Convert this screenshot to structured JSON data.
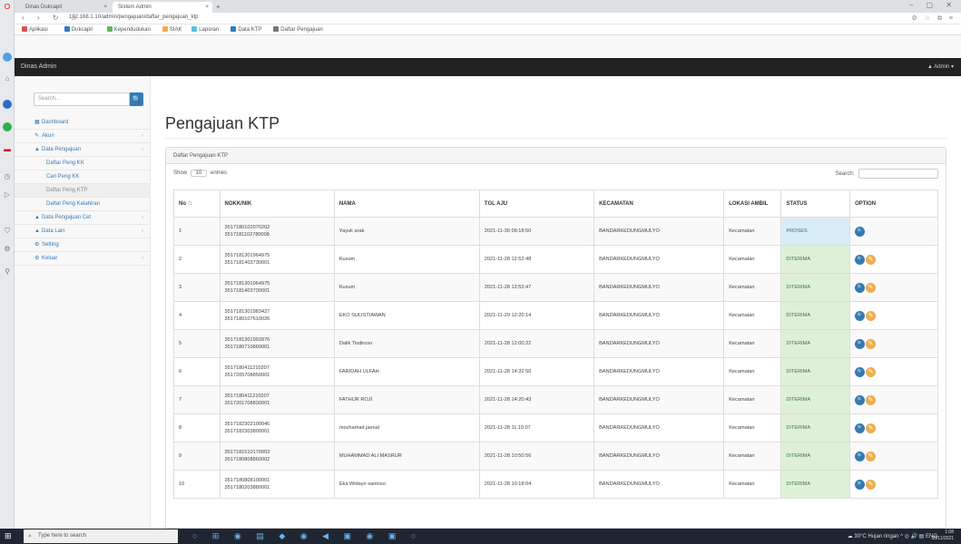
{
  "browser": {
    "tabs": [
      {
        "title": "Dinas Dukcapil",
        "close": "×"
      },
      {
        "title": "Sistem Admin",
        "close": "×"
      }
    ],
    "new_tab": "+",
    "window_controls": "– ▢ ✕",
    "nav_glyphs": "‹ › ↻ ⌂",
    "url": "192.168.1.10/admin/pengajuan/daftar_pengajuan_ktp",
    "extensions": "⚙ ☆ ⧉ ≡",
    "bookmarks": [
      {
        "label": "Aplikasi",
        "color": "#d9534f"
      },
      {
        "label": "Dukcapil",
        "color": "#337ab7"
      },
      {
        "label": "Kependudukan",
        "color": "#5cb85c"
      },
      {
        "label": "SIAK",
        "color": "#f0ad4e"
      },
      {
        "label": "Laporan",
        "color": "#5bc0de"
      },
      {
        "label": "Data KTP",
        "color": "#337ab7"
      },
      {
        "label": "Daftar Pengajuan",
        "color": "#777777"
      }
    ]
  },
  "app": {
    "brand": "Dinas Admin",
    "user_menu": "▲ Admin ▾"
  },
  "sidebar": {
    "search_placeholder": "Search...",
    "search_button": "🔍",
    "items": [
      {
        "label": "Dashboard",
        "icon": "▦",
        "level": "top",
        "caret": ""
      },
      {
        "label": "Akun",
        "icon": "✎",
        "level": "top",
        "caret": "‹"
      },
      {
        "label": "Data Pengajuan",
        "icon": "▲",
        "level": "top",
        "caret": "‹"
      },
      {
        "label": "Daftar Peng KK",
        "icon": "",
        "level": "sub",
        "caret": ""
      },
      {
        "label": "Cari Peng KK",
        "icon": "",
        "level": "sub",
        "caret": ""
      },
      {
        "label": "Daftar Peng KTP",
        "icon": "",
        "level": "sub",
        "active": true,
        "caret": ""
      },
      {
        "label": "Daftar Peng Kelahiran",
        "icon": "",
        "level": "sub",
        "caret": ""
      },
      {
        "label": "Data Pengajuan Cet",
        "icon": "▲",
        "level": "top",
        "caret": "‹"
      },
      {
        "label": "Data Lain",
        "icon": "▲",
        "level": "top",
        "caret": "‹"
      },
      {
        "label": "Setting",
        "icon": "⚙",
        "level": "top",
        "caret": ""
      },
      {
        "label": "Keluar",
        "icon": "⚙",
        "level": "top",
        "caret": "‹"
      }
    ]
  },
  "main": {
    "title": "Pengajuan KTP",
    "panel_heading": "Daftar Pengajuan KTP",
    "show_label": "Show",
    "show_value": "10",
    "entries_label": "entries",
    "search_label": "Search:",
    "columns": [
      "No",
      "NOKK/NIK",
      "NAMA",
      "TGL AJU",
      "KECAMATAN",
      "LOKASI AMBIL",
      "STATUS",
      "OPTION"
    ],
    "rows": [
      {
        "no": "1",
        "nik1": "3517180102070202",
        "nik2": "3517181102780008",
        "nama": "Yayuk arak",
        "tgl": "2021-11-30 09:18:50",
        "kec": "BANDARKEDUNGMULYO",
        "lokasi": "Kecamatan",
        "status": "PROSES",
        "kind": "proses",
        "edit": false
      },
      {
        "no": "2",
        "nik1": "3517181301964975",
        "nik2": "3517181403730001",
        "nama": "Kusum",
        "tgl": "2021-11-28 12:52:48",
        "kec": "BANDARKEDUNGMULYO",
        "lokasi": "Kecamatan",
        "status": "DITERIMA",
        "kind": "ok",
        "edit": true
      },
      {
        "no": "3",
        "nik1": "3517181301964975",
        "nik2": "3517181403730001",
        "nama": "Kusum",
        "tgl": "2021-11-28 12:53:47",
        "kec": "BANDARKEDUNGMULYO",
        "lokasi": "Kecamatan",
        "status": "DITERIMA",
        "kind": "ok",
        "edit": true
      },
      {
        "no": "4",
        "nik1": "3517181301983427",
        "nik2": "3517180107610026",
        "nama": "EKO SULISTIAWAN",
        "tgl": "2021-11-29 12:20:14",
        "kec": "BANDARKEDUNGMULYO",
        "lokasi": "Kecamatan",
        "status": "DITERIMA",
        "kind": "ok",
        "edit": true
      },
      {
        "no": "5",
        "nik1": "3517181301993976",
        "nik2": "3517180710860001",
        "nama": "Dalik Tisdiroso",
        "tgl": "2021-11-28 12:00:22",
        "kec": "BANDARKEDUNGMULYO",
        "lokasi": "Kecamatan",
        "status": "DITERIMA",
        "kind": "ok",
        "edit": true
      },
      {
        "no": "6",
        "nik1": "3517180411210207",
        "nik2": "3517205708850001",
        "nama": "FARIDAH ULFAH",
        "tgl": "2021-11-28 14:32:50",
        "kec": "BANDARKEDUNGMULYO",
        "lokasi": "Kecamatan",
        "status": "DITERIMA",
        "kind": "ok",
        "edit": true
      },
      {
        "no": "7",
        "nik1": "3517180411210207",
        "nik2": "3517201708830001",
        "nama": "FATHUR ROJI",
        "tgl": "2021-11-28 14:20:43",
        "kec": "BANDARKEDUNGMULYO",
        "lokasi": "Kecamatan",
        "status": "DITERIMA",
        "kind": "ok",
        "edit": true
      },
      {
        "no": "8",
        "nik1": "3517182302100046",
        "nik2": "3517182303800001",
        "nama": "mochamad jaenal",
        "tgl": "2021-11-28 11:15:07",
        "kec": "BANDARKEDUNGMULYO",
        "lokasi": "Kecamatan",
        "status": "DITERIMA",
        "kind": "ok",
        "edit": true
      },
      {
        "no": "9",
        "nik1": "3517181510170003",
        "nik2": "3517180808860002",
        "nama": "MUHAMMAD ALI MASRUR",
        "tgl": "2021-11-28 10:50:56",
        "kec": "BANDARKEDUNGMULYO",
        "lokasi": "Kecamatan",
        "status": "DITERIMA",
        "kind": "ok",
        "edit": true
      },
      {
        "no": "10",
        "nik1": "3517180808100001",
        "nik2": "3517180203880001",
        "nama": "Eka Widayo santoso",
        "tgl": "2021-11-28 10:18:04",
        "kec": "BANDARKEDUNGMULYO",
        "lokasi": "Kecamatan",
        "status": "DITERIMA",
        "kind": "ok",
        "edit": true
      }
    ],
    "view_icon": "🔍",
    "edit_icon": "✎",
    "sort_glyph": "⇅"
  },
  "taskbar": {
    "search_placeholder": "Type here to search",
    "search_icon": "⌕",
    "apps": "○ ⊞ ◉ ▤ ◆ ◉ ◀ ▣ ◉ ▣ ○",
    "tray": "☁ 30°C Hujan ringan  ^  ◎ 🔊 ▤ ENG",
    "time": "1:08",
    "date": "30/11/2021"
  }
}
